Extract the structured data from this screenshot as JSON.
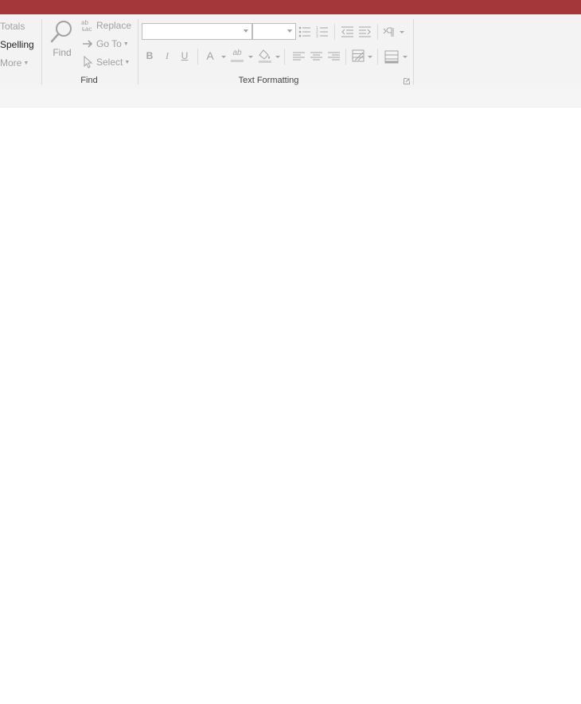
{
  "colors": {
    "titlebar": "#a4373a",
    "ribbon_bg": "#f3f3f3",
    "disabled_text": "#a0a0a0"
  },
  "records_group": {
    "totals_label": "Totals",
    "spelling_label": "Spelling",
    "more_label": "More"
  },
  "find_group": {
    "label": "Find",
    "find_label": "Find",
    "replace_label": "Replace",
    "goto_label": "Go To",
    "select_label": "Select"
  },
  "text_formatting_group": {
    "label": "Text Formatting",
    "font_name": "",
    "font_size": "",
    "bold_label": "B",
    "italic_label": "I",
    "underline_label": "U",
    "font_color_label": "A",
    "highlight_label": "ab"
  },
  "icons": [
    "magnifier-icon",
    "replace-icon",
    "arrow-right-icon",
    "pointer-icon",
    "bullets-icon",
    "numbering-icon",
    "decrease-indent-icon",
    "increase-indent-icon",
    "paragraph-direction-icon",
    "align-left-icon",
    "align-center-icon",
    "align-right-icon",
    "background-color-icon",
    "gridlines-icon",
    "alternate-row-color-icon",
    "dialog-launcher-icon"
  ]
}
